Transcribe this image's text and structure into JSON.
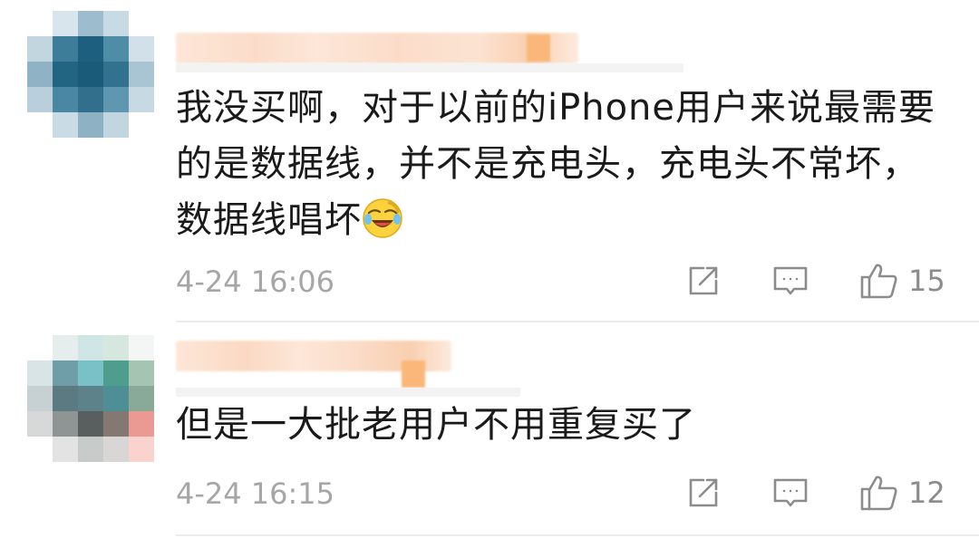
{
  "comments": [
    {
      "avatar_colors": [
        [
          "#ffffff",
          "#d8e5ec",
          "#9dbccd",
          "#c8dbe4",
          "#ffffff"
        ],
        [
          "#c2d6e0",
          "#3d7d99",
          "#1d5f7e",
          "#4f8ca6",
          "#d2e1e9"
        ],
        [
          "#8fb2c4",
          "#226582",
          "#195b79",
          "#33728f",
          "#a9c5d3"
        ],
        [
          "#b9cfdb",
          "#4a87a2",
          "#316f8c",
          "#5f97b0",
          "#c7d9e2"
        ],
        [
          "#ffffff",
          "#c9dbe4",
          "#8eb2c4",
          "#c2d6df",
          "#ffffff"
        ]
      ],
      "content": "我没买啊，对于以前的iPhone用户来说最需要的是数据线，并不是充电头，充电头不常坏，数据线唱坏",
      "emoji_icon": "laugh-cry-emoji-icon",
      "time": "4-24 16:06",
      "likes": "15"
    },
    {
      "avatar_colors": [
        [
          "#ffffff",
          "#e5eded",
          "#d0e6e6",
          "#d6e8de",
          "#f3f6f4"
        ],
        [
          "#d9e4e6",
          "#6f9ea8",
          "#79c1c7",
          "#4f9d8c",
          "#a5c4b2"
        ],
        [
          "#c7d1d4",
          "#5c7a81",
          "#5d8289",
          "#4d8f94",
          "#89aa97"
        ],
        [
          "#d7d9d9",
          "#8f9594",
          "#595f5e",
          "#847872",
          "#eb9a93"
        ],
        [
          "#ffffff",
          "#e3e3e3",
          "#c7cccb",
          "#d9d7d5",
          "#fad3cf"
        ]
      ],
      "content": "但是一大批老用户不用重复买了",
      "emoji_icon": "",
      "time": "4-24 16:15",
      "likes": "12"
    }
  ],
  "icons": {
    "repost": "repost-icon",
    "comment": "comment-icon",
    "like": "thumbs-up-icon"
  },
  "colors": {
    "text": "#1a1a1a",
    "meta": "#a6a6a6",
    "icon": "#8c8c8c",
    "divider": "#ececec"
  }
}
